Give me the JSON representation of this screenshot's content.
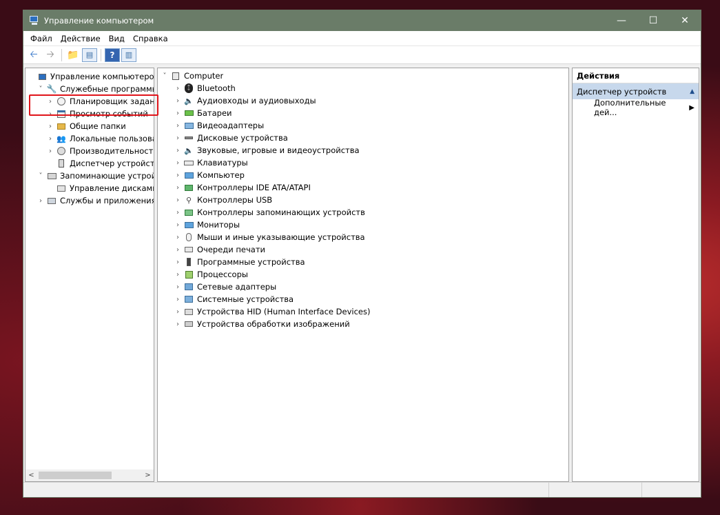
{
  "window": {
    "title": "Управление компьютером"
  },
  "menu": [
    "Файл",
    "Действие",
    "Вид",
    "Справка"
  ],
  "left_tree": [
    {
      "label": "Управление компьютером (л",
      "indent": 0,
      "expander": "",
      "icon": "computer-management-icon"
    },
    {
      "label": "Служебные программы",
      "indent": 1,
      "expander": "˅",
      "icon": "tools-icon"
    },
    {
      "label": "Планировщик заданий",
      "indent": 2,
      "expander": "›",
      "icon": "clock-icon"
    },
    {
      "label": "Просмотр событий",
      "indent": 2,
      "expander": "›",
      "icon": "event-viewer-icon"
    },
    {
      "label": "Общие папки",
      "indent": 2,
      "expander": "›",
      "icon": "shared-folder-icon"
    },
    {
      "label": "Локальные пользовате",
      "indent": 2,
      "expander": "›",
      "icon": "users-icon"
    },
    {
      "label": "Производительность",
      "indent": 2,
      "expander": "›",
      "icon": "performance-icon"
    },
    {
      "label": "Диспетчер устройств",
      "indent": 2,
      "expander": "",
      "icon": "device-manager-icon"
    },
    {
      "label": "Запоминающие устройс",
      "indent": 1,
      "expander": "˅",
      "icon": "storage-icon"
    },
    {
      "label": "Управление дисками",
      "indent": 2,
      "expander": "",
      "icon": "disk-management-icon"
    },
    {
      "label": "Службы и приложения",
      "indent": 1,
      "expander": "›",
      "icon": "services-icon"
    }
  ],
  "device_root": {
    "label": "Computer",
    "expander": "˅",
    "icon": "computer-icon"
  },
  "devices": [
    {
      "label": "Bluetooth",
      "icon": "bluetooth-icon"
    },
    {
      "label": "Аудиовходы и аудиовыходы",
      "icon": "speaker-icon"
    },
    {
      "label": "Батареи",
      "icon": "battery-icon"
    },
    {
      "label": "Видеоадаптеры",
      "icon": "display-adapter-icon"
    },
    {
      "label": "Дисковые устройства",
      "icon": "disk-drive-icon"
    },
    {
      "label": "Звуковые, игровые и видеоустройства",
      "icon": "sound-icon"
    },
    {
      "label": "Клавиатуры",
      "icon": "keyboard-icon"
    },
    {
      "label": "Компьютер",
      "icon": "monitor-icon"
    },
    {
      "label": "Контроллеры IDE ATA/ATAPI",
      "icon": "ide-controller-icon"
    },
    {
      "label": "Контроллеры USB",
      "icon": "usb-icon"
    },
    {
      "label": "Контроллеры запоминающих устройств",
      "icon": "storage-controller-icon"
    },
    {
      "label": "Мониторы",
      "icon": "monitor-icon"
    },
    {
      "label": "Мыши и иные указывающие устройства",
      "icon": "mouse-icon"
    },
    {
      "label": "Очереди печати",
      "icon": "printer-icon"
    },
    {
      "label": "Программные устройства",
      "icon": "software-device-icon"
    },
    {
      "label": "Процессоры",
      "icon": "processor-icon"
    },
    {
      "label": "Сетевые адаптеры",
      "icon": "network-adapter-icon"
    },
    {
      "label": "Системные устройства",
      "icon": "system-device-icon"
    },
    {
      "label": "Устройства HID (Human Interface Devices)",
      "icon": "hid-icon"
    },
    {
      "label": "Устройства обработки изображений",
      "icon": "camera-icon"
    }
  ],
  "actions": {
    "title": "Действия",
    "section": "Диспетчер устройств",
    "item": "Дополнительные дей..."
  },
  "colors": {
    "titlebar": "#6a7c68",
    "selection": "#c7d8ec",
    "highlight_box": "#e0141a"
  }
}
